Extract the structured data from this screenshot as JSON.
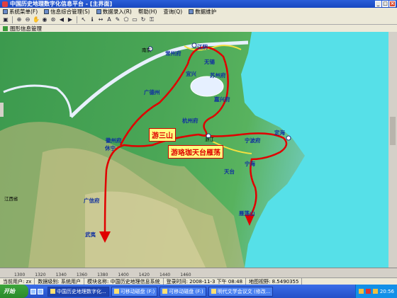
{
  "window": {
    "title": "中国历史地理数字化信息平台 - [主界面]"
  },
  "menu": [
    "系统菜单(F)",
    "信息综合管理(S)",
    "数据录入(R)",
    "帮助(H)",
    "查询(Q)",
    "数据维护"
  ],
  "layer_panel": {
    "label": "图形信息管理"
  },
  "map": {
    "place_labels": [
      "南京",
      "常州府",
      "江阴",
      "无锡",
      "宜兴",
      "苏州府",
      "广德州",
      "嘉兴府",
      "杭州府",
      "浙江",
      "徽州府",
      "休宁",
      "宁波府",
      "定海",
      "天台",
      "宁海",
      "广信府",
      "江西省",
      "雁荡山",
      "武夷"
    ],
    "callouts": [
      "游三山",
      "游珞珈天台雁荡"
    ],
    "colors": {
      "route": "#e00000",
      "sea": "#56e0e8",
      "land": "#3c9a4e",
      "river": "#e8f0ff"
    }
  },
  "scale_ticks": [
    "1300",
    "1320",
    "1340",
    "1360",
    "1380",
    "1400",
    "1420",
    "1440",
    "1460"
  ],
  "status": {
    "user": "当前用户: zx",
    "level": "数据级别: 系统用户",
    "module": "模块名称: 中国历史地理信息系统",
    "login_time": "登录时间: 2008-11-3 下午 08:48",
    "view": "地图视野: 8.5490355"
  },
  "taskbar": {
    "start": "开始",
    "tasks": [
      "中国历史地理数字化...",
      "可移动磁盘 (F:)",
      "可移动磁盘 (F:)",
      "明代文学会议文 (修改..."
    ],
    "clock": "20:56"
  }
}
